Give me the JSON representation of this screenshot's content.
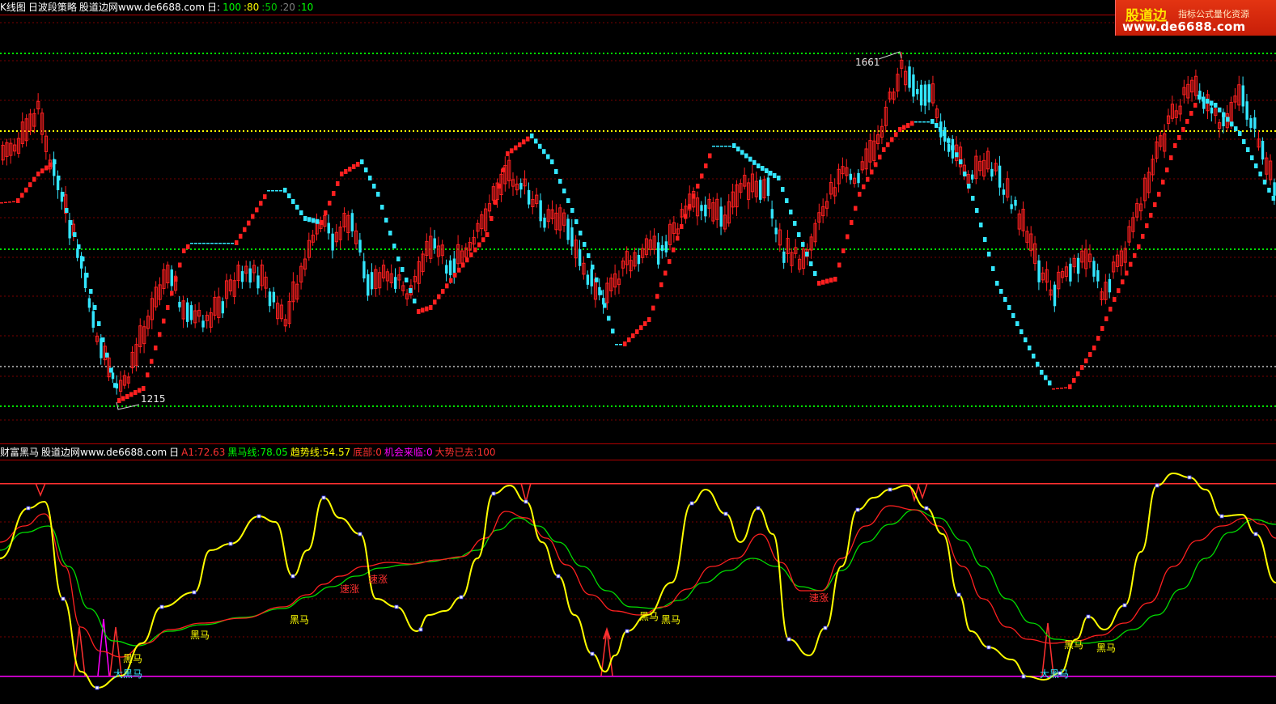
{
  "top_panel": {
    "header": [
      {
        "text": "K线图",
        "color": "#ffffff"
      },
      {
        "text": "日波段策略",
        "color": "#ffffff"
      },
      {
        "text": "股道边网www.de6688.com",
        "color": "#ffffff"
      },
      {
        "text": "日:",
        "color": "#ffffff"
      },
      {
        "text": "100",
        "color": "#00ff00"
      },
      {
        "text": ":80",
        "color": "#ffff00"
      },
      {
        "text": ":50",
        "color": "#00cc00"
      },
      {
        "text": ":20",
        "color": "#808080"
      },
      {
        "text": ":10",
        "color": "#00ff00"
      }
    ],
    "price_high_label": "1661",
    "price_low_label": "1215"
  },
  "logo": {
    "brand": "股道边",
    "tagline": "指标公式量化资源",
    "url": "www.de6688.com"
  },
  "bottom_panel": {
    "header": [
      {
        "text": "财富黑马",
        "color": "#ffffff"
      },
      {
        "text": "股道边网www.de6688.com",
        "color": "#ffffff"
      },
      {
        "text": "日",
        "color": "#ffffff"
      },
      {
        "text": "A1:72.63",
        "color": "#ff3030"
      },
      {
        "text": "黑马线:78.05",
        "color": "#00ff00"
      },
      {
        "text": "趋势线:54.57",
        "color": "#ffff00"
      },
      {
        "text": "底部:0",
        "color": "#ff3030"
      },
      {
        "text": "机会来临:0",
        "color": "#ff00ff"
      },
      {
        "text": "大势已去:100",
        "color": "#ff3030"
      }
    ],
    "labels": {
      "heima": "黑马",
      "da_heima": "大黑马",
      "bao_zhang": "速涨"
    }
  },
  "colors": {
    "background": "#000000",
    "up_candle": "#ff2020",
    "down_candle": "#33e6ff",
    "grid": "#7a0000",
    "green_dotted": "#00e000",
    "yellow_dotted": "#ffff00",
    "gray_dotted": "#909090",
    "yellow_line": "#ffff00",
    "red_line": "#ff2020",
    "green_line": "#00dd00",
    "magenta": "#ff00ff",
    "logo_red": "#d62a10"
  }
}
